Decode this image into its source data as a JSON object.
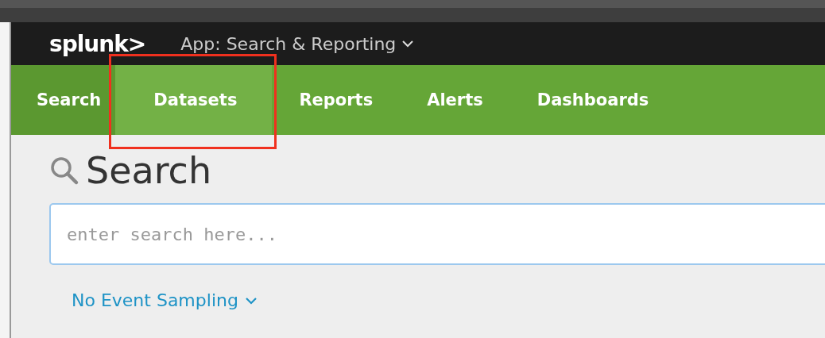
{
  "header": {
    "logo": "splunk>",
    "app_menu": "App: Search & Reporting"
  },
  "tabs": [
    {
      "label": "Search",
      "selected": true,
      "highlighted": false
    },
    {
      "label": "Datasets",
      "selected": false,
      "highlighted": true
    },
    {
      "label": "Reports",
      "selected": false,
      "highlighted": false
    },
    {
      "label": "Alerts",
      "selected": false,
      "highlighted": false
    },
    {
      "label": "Dashboards",
      "selected": false,
      "highlighted": false
    }
  ],
  "page": {
    "title": "Search",
    "search": {
      "placeholder": "enter search here..."
    },
    "sampling": "No Event Sampling"
  }
}
